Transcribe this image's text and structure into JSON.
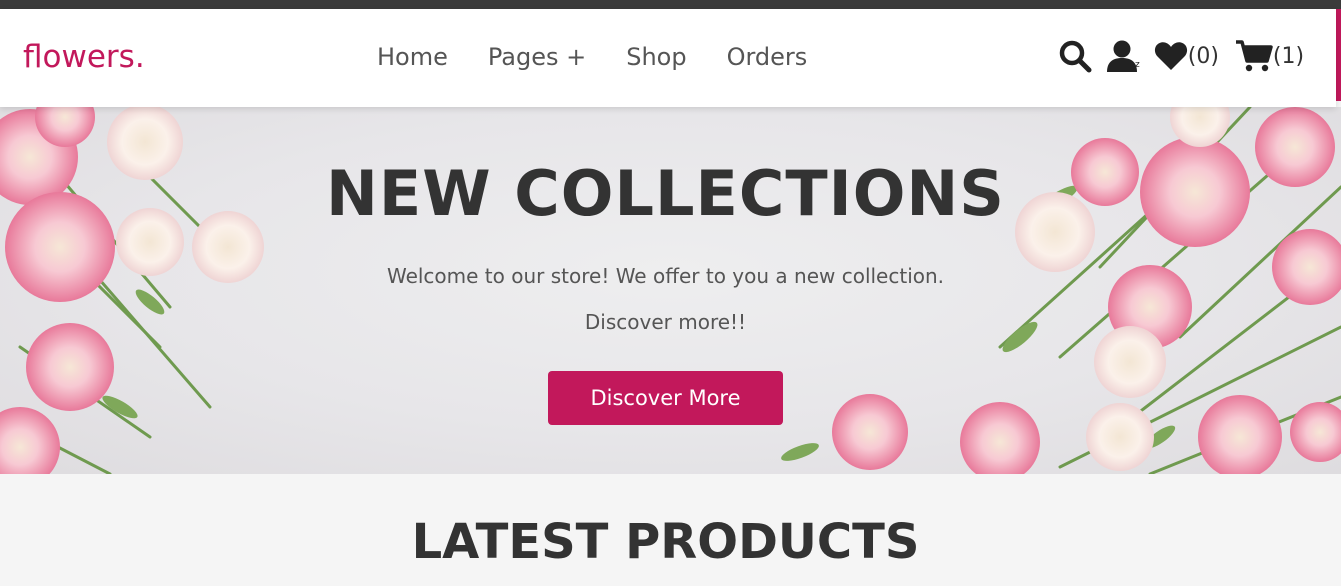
{
  "header": {
    "logo": "flowers.",
    "nav": [
      "Home",
      "Pages +",
      "Shop",
      "Orders"
    ],
    "icons": {
      "search": "search-icon",
      "user": "user-icon",
      "user_badge": "z",
      "wishlist": "heart-icon",
      "wishlist_count": "(0)",
      "cart": "cart-icon",
      "cart_count": "(1)"
    }
  },
  "hero": {
    "title": "NEW COLLECTIONS",
    "subtitle_line1": "Welcome to our store! We offer to you a new collection.",
    "subtitle_line2": "Discover more!!",
    "cta_label": "Discover More"
  },
  "latest": {
    "title": "LATEST PRODUCTS"
  },
  "colors": {
    "accent": "#c2185b",
    "dark_text": "#333333",
    "nav_text": "#555555",
    "top_strip": "#3b3b3b"
  }
}
